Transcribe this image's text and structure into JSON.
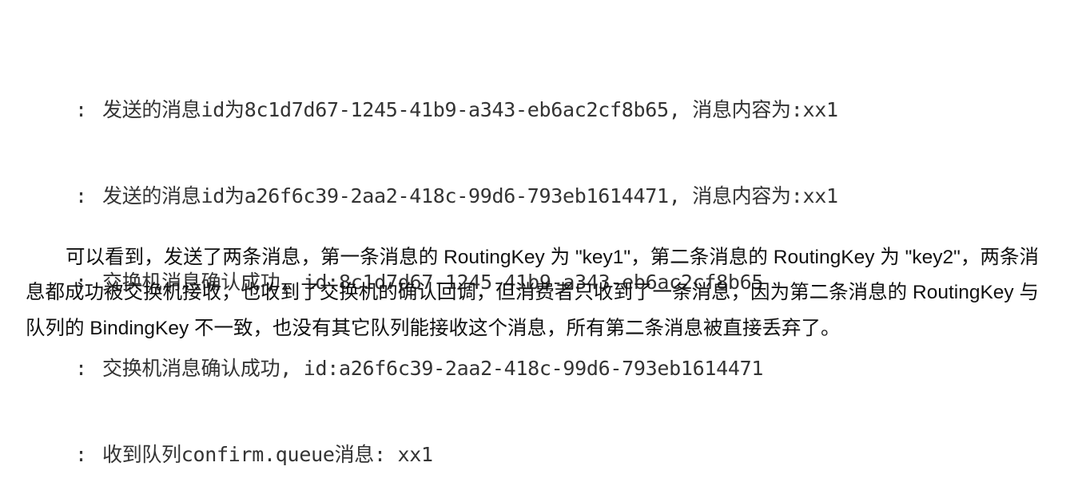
{
  "log": {
    "lines": [
      {
        "prefix": ":",
        "text": "发送的消息id为8c1d7d67-1245-41b9-a343-eb6ac2cf8b65, 消息内容为:xx1"
      },
      {
        "prefix": ":",
        "text": "发送的消息id为a26f6c39-2aa2-418c-99d6-793eb1614471, 消息内容为:xx1"
      },
      {
        "prefix": ":",
        "text": "交换机消息确认成功, id:8c1d7d67-1245-41b9-a343-eb6ac2cf8b65"
      },
      {
        "prefix": ":",
        "text": "交换机消息确认成功, id:a26f6c39-2aa2-418c-99d6-793eb1614471"
      },
      {
        "prefix": ":",
        "text": "收到队列confirm.queue消息: xx1"
      }
    ]
  },
  "paragraph": {
    "text": "可以看到，发送了两条消息，第一条消息的 RoutingKey 为 \"key1\"，第二条消息的 RoutingKey 为 \"key2\"，两条消息都成功被交换机接收，也收到了交换机的确认回调，但消费者只收到了一条消息，因为第二条消息的 RoutingKey 与队列的 BindingKey 不一致，也没有其它队列能接收这个消息，所有第二条消息被直接丢弃了。"
  }
}
